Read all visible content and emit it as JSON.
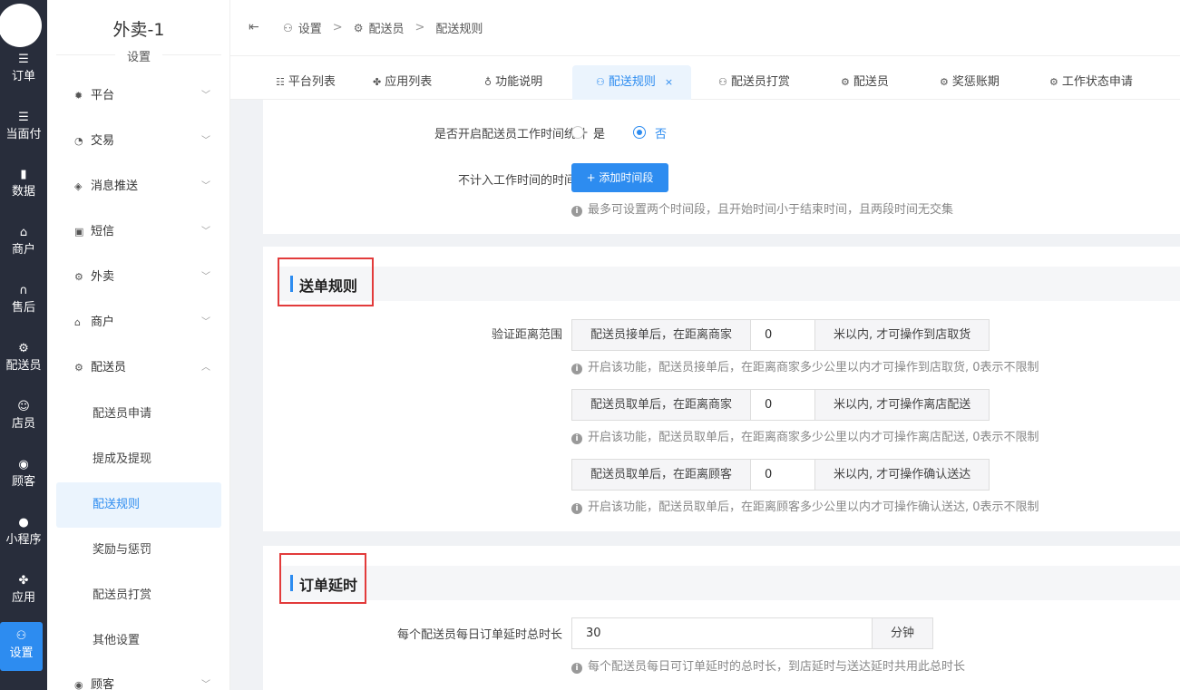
{
  "rail": {
    "items": [
      {
        "label": "订单",
        "icon": "list-icon"
      },
      {
        "label": "当面付",
        "icon": "list-icon"
      },
      {
        "label": "数据",
        "icon": "bar-chart-icon"
      },
      {
        "label": "商户",
        "icon": "store-icon"
      },
      {
        "label": "售后",
        "icon": "headset-icon"
      },
      {
        "label": "配送员",
        "icon": "scooter-icon"
      },
      {
        "label": "店员",
        "icon": "users-icon"
      },
      {
        "label": "顾客",
        "icon": "user-circle-icon"
      },
      {
        "label": "小程序",
        "icon": "wechat-icon"
      },
      {
        "label": "应用",
        "icon": "apps-icon"
      },
      {
        "label": "设置",
        "icon": "settings-user-icon"
      }
    ]
  },
  "sidebar": {
    "shop_name": "外卖-1",
    "subtitle": "设置",
    "menu": [
      {
        "label": "平台",
        "icon": "gear-icon"
      },
      {
        "label": "交易",
        "icon": "coin-icon"
      },
      {
        "label": "消息推送",
        "icon": "bell-off-icon"
      },
      {
        "label": "短信",
        "icon": "chat-icon"
      },
      {
        "label": "外卖",
        "icon": "scooter-icon"
      },
      {
        "label": "商户",
        "icon": "store-icon"
      },
      {
        "label": "配送员",
        "icon": "scooter-icon"
      }
    ],
    "submenu": [
      "配送员申请",
      "提成及提现",
      "配送规则",
      "奖励与惩罚",
      "配送员打赏",
      "其他设置"
    ],
    "bottom_item": "顾客"
  },
  "breadcrumb": [
    "设置",
    "配送员",
    "配送规则"
  ],
  "tabs": [
    "平台列表",
    "应用列表",
    "功能说明",
    "配送规则",
    "配送员打赏",
    "配送员",
    "奖惩账期",
    "工作状态申请"
  ],
  "work_time": {
    "label": "是否开启配送员工作时间统计",
    "yes": "是",
    "no": "否",
    "exclude_label": "不计入工作时间的时间段",
    "add_button": "+ 添加时间段",
    "tip": "最多可设置两个时间段，且开始时间小于结束时间，且两段时间无交集"
  },
  "dispatch_rules": {
    "title": "送单规则",
    "range_label": "验证距离范围",
    "rows": [
      {
        "prefix": "配送员接单后，在距离商家",
        "value": "0",
        "suffix": "米以内, 才可操作到店取货",
        "tip": "开启该功能，配送员接单后，在距离商家多少公里以内才可操作到店取货, 0表示不限制"
      },
      {
        "prefix": "配送员取单后，在距离商家",
        "value": "0",
        "suffix": "米以内, 才可操作离店配送",
        "tip": "开启该功能，配送员取单后，在距离商家多少公里以内才可操作离店配送, 0表示不限制"
      },
      {
        "prefix": "配送员取单后，在距离顾客",
        "value": "0",
        "suffix": "米以内, 才可操作确认送达",
        "tip": "开启该功能，配送员取单后，在距离顾客多少公里以内才可操作确认送达, 0表示不限制"
      }
    ]
  },
  "order_delay": {
    "title": "订单延时",
    "label": "每个配送员每日订单延时总时长",
    "value": "30",
    "unit": "分钟",
    "tip": "每个配送员每日可订单延时的总时长，到店延时与送达延时共用此总时长"
  }
}
